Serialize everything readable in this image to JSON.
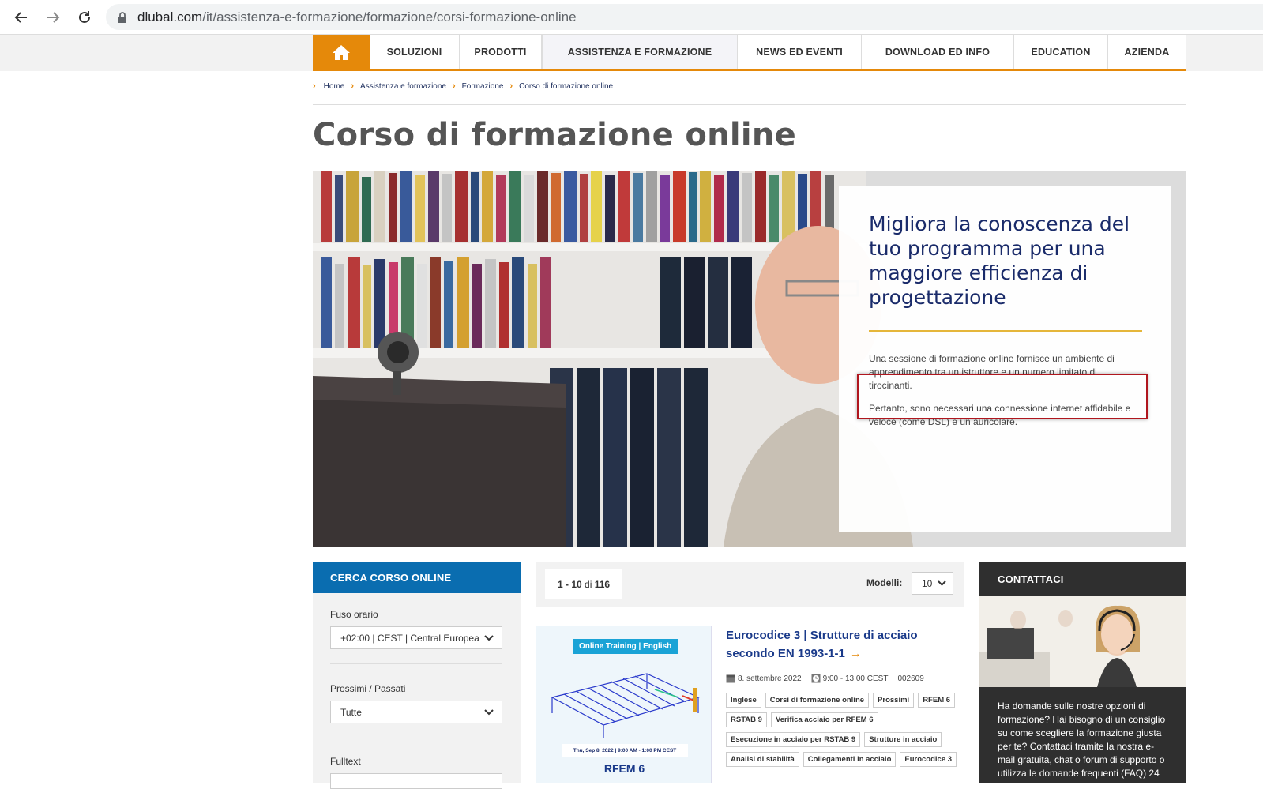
{
  "browser": {
    "url_domain": "dlubal.com",
    "url_path": "/it/assistenza-e-formazione/formazione/corsi-formazione-online"
  },
  "nav": {
    "items": [
      {
        "label": "SOLUZIONI"
      },
      {
        "label": "PRODOTTI"
      },
      {
        "label": "ASSISTENZA E FORMAZIONE"
      },
      {
        "label": "NEWS ED EVENTI"
      },
      {
        "label": "DOWNLOAD ED INFO"
      },
      {
        "label": "EDUCATION"
      },
      {
        "label": "AZIENDA"
      }
    ]
  },
  "breadcrumb": [
    "Home",
    "Assistenza e formazione",
    "Formazione",
    "Corso di formazione online"
  ],
  "page": {
    "title": "Corso di formazione online"
  },
  "hero": {
    "heading": "Migliora la conoscenza del tuo programma per una maggiore efficienza di progettazione",
    "p1": "Una sessione di formazione online fornisce un ambiente di apprendimento tra un istruttore e un numero limitato di tirocinanti.",
    "p2": "Pertanto, sono necessari una connessione internet affidabile e veloce (come DSL) e un auricolare."
  },
  "search": {
    "title": "CERCA CORSO ONLINE",
    "timezone_label": "Fuso orario",
    "timezone_value": "+02:00 | CEST | Central Europea",
    "upcoming_label": "Prossimi / Passati",
    "upcoming_value": "Tutte",
    "fulltext_label": "Fulltext"
  },
  "results": {
    "range": "1 - 10",
    "of": "di",
    "total": "116",
    "models_label": "Modelli:",
    "models_value": "10"
  },
  "course": {
    "thumb_badge": "Online Training | English",
    "thumb_date": "Thu, Sep 8, 2022 | 9:00 AM - 1:00 PM CEST",
    "thumb_product": "RFEM 6",
    "title": "Eurocodice 3 | Strutture di acciaio secondo EN 1993-1-1",
    "date": "8. settembre 2022",
    "time": "9:00 - 13:00 CEST",
    "code": "002609",
    "tags": [
      "Inglese",
      "Corsi di formazione online",
      "Prossimi",
      "RFEM 6",
      "RSTAB 9",
      "Verifica acciaio per RFEM 6",
      "Esecuzione in acciaio per RSTAB 9",
      "Strutture in acciaio",
      "Analisi di stabilità",
      "Collegamenti in acciaio",
      "Eurocodice 3"
    ]
  },
  "contact": {
    "title": "CONTATTACI",
    "text": "Ha domande sulle nostre opzioni di formazione? Hai bisogno di un consiglio su come scegliere la formazione giusta per te? Contattaci tramite la nostra e-mail gratuita, chat o forum di supporto o utilizza le domande frequenti (FAQ) 24"
  },
  "colors": {
    "accent": "#e5890a",
    "blue": "#0a6db0",
    "highlight": "#b0161e"
  }
}
